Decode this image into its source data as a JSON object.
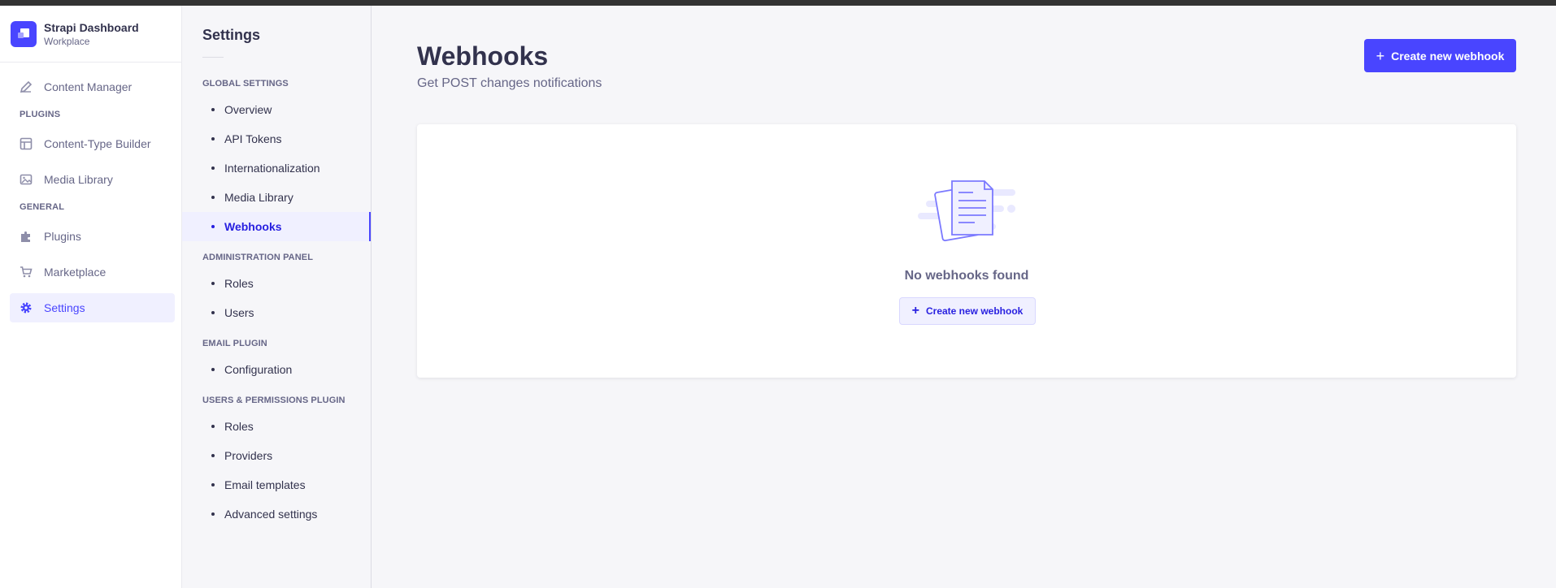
{
  "app": {
    "name": "Strapi Dashboard",
    "workspace": "Workplace",
    "brand_color": "#4945ff"
  },
  "mainnav": {
    "content_manager": "Content Manager",
    "plugins_section": "PLUGINS",
    "content_type_builder": "Content-Type Builder",
    "media_library": "Media Library",
    "general_section": "GENERAL",
    "plugins": "Plugins",
    "marketplace": "Marketplace",
    "settings": "Settings"
  },
  "subnav": {
    "title": "Settings",
    "global_section": "GLOBAL SETTINGS",
    "overview": "Overview",
    "api_tokens": "API Tokens",
    "i18n": "Internationalization",
    "media_library": "Media Library",
    "webhooks": "Webhooks",
    "admin_section": "ADMINISTRATION PANEL",
    "admin_roles": "Roles",
    "admin_users": "Users",
    "email_section": "EMAIL PLUGIN",
    "configuration": "Configuration",
    "up_section": "USERS & PERMISSIONS PLUGIN",
    "up_roles": "Roles",
    "providers": "Providers",
    "email_templates": "Email templates",
    "advanced_settings": "Advanced settings"
  },
  "page": {
    "title": "Webhooks",
    "subtitle": "Get POST changes notifications",
    "create_button": "Create new webhook",
    "empty_text": "No webhooks found",
    "empty_create_button": "Create new webhook"
  }
}
